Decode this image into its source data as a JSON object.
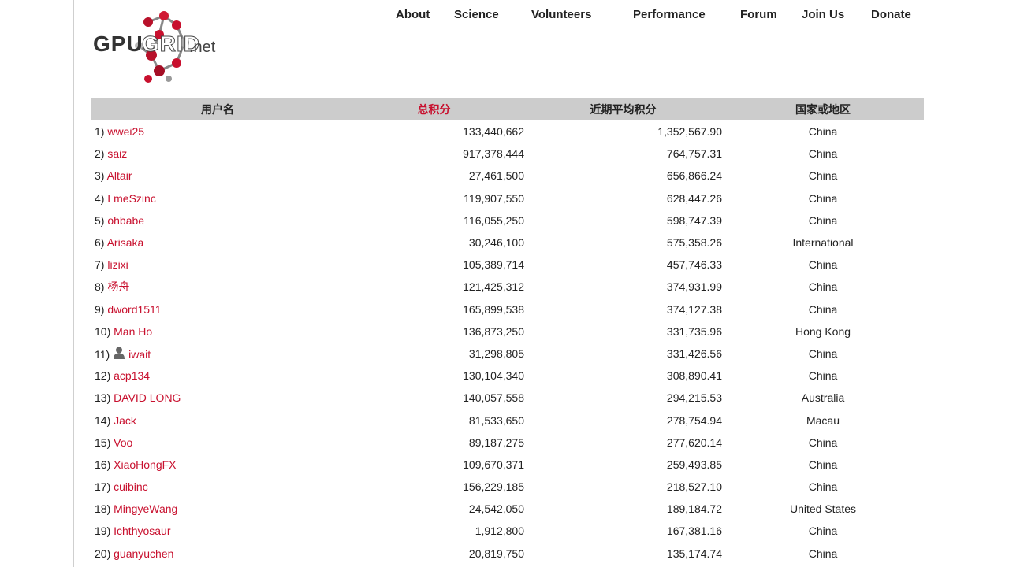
{
  "logo": {
    "gpu": "GPU",
    "grid": "GRID",
    "net": ".net"
  },
  "nav": [
    {
      "label": "About"
    },
    {
      "label": "Science"
    },
    {
      "label": "Volunteers"
    },
    {
      "label": "Performance"
    },
    {
      "label": "Forum"
    },
    {
      "label": "Join Us"
    },
    {
      "label": "Donate"
    }
  ],
  "table": {
    "headers": [
      "用户名",
      "总积分",
      "近期平均积分",
      "国家或地区"
    ],
    "rows": [
      {
        "rank": "1)",
        "name": "wwei25",
        "total": "133,440,662",
        "rac": "1,352,567.90",
        "country": "China"
      },
      {
        "rank": "2)",
        "name": "saiz",
        "total": "917,378,444",
        "rac": "764,757.31",
        "country": "China"
      },
      {
        "rank": "3)",
        "name": "Altair",
        "total": "27,461,500",
        "rac": "656,866.24",
        "country": "China"
      },
      {
        "rank": "4)",
        "name": "LmeSzinc",
        "total": "119,907,550",
        "rac": "628,447.26",
        "country": "China"
      },
      {
        "rank": "5)",
        "name": "ohbabe",
        "total": "116,055,250",
        "rac": "598,747.39",
        "country": "China"
      },
      {
        "rank": "6)",
        "name": "Arisaka",
        "total": "30,246,100",
        "rac": "575,358.26",
        "country": "International"
      },
      {
        "rank": "7)",
        "name": "lizixi",
        "total": "105,389,714",
        "rac": "457,746.33",
        "country": "China"
      },
      {
        "rank": "8)",
        "name": "杨舟",
        "total": "121,425,312",
        "rac": "374,931.99",
        "country": "China"
      },
      {
        "rank": "9)",
        "name": "dword1511",
        "total": "165,899,538",
        "rac": "374,127.38",
        "country": "China"
      },
      {
        "rank": "10)",
        "name": "Man Ho",
        "total": "136,873,250",
        "rac": "331,735.96",
        "country": "Hong Kong"
      },
      {
        "rank": "11)",
        "name": "iwait",
        "total": "31,298,805",
        "rac": "331,426.56",
        "country": "China",
        "has_icon": true
      },
      {
        "rank": "12)",
        "name": "acp134",
        "total": "130,104,340",
        "rac": "308,890.41",
        "country": "China"
      },
      {
        "rank": "13)",
        "name": "DAVID LONG",
        "total": "140,057,558",
        "rac": "294,215.53",
        "country": "Australia"
      },
      {
        "rank": "14)",
        "name": "Jack",
        "total": "81,533,650",
        "rac": "278,754.94",
        "country": "Macau"
      },
      {
        "rank": "15)",
        "name": "Voo",
        "total": "89,187,275",
        "rac": "277,620.14",
        "country": "China"
      },
      {
        "rank": "16)",
        "name": "XiaoHongFX",
        "total": "109,670,371",
        "rac": "259,493.85",
        "country": "China"
      },
      {
        "rank": "17)",
        "name": "cuibinc",
        "total": "156,229,185",
        "rac": "218,527.10",
        "country": "China"
      },
      {
        "rank": "18)",
        "name": "MingyeWang",
        "total": "24,542,050",
        "rac": "189,184.72",
        "country": "United States"
      },
      {
        "rank": "19)",
        "name": "Ichthyosaur",
        "total": "1,912,800",
        "rac": "167,381.16",
        "country": "China"
      },
      {
        "rank": "20)",
        "name": "guanyuchen",
        "total": "20,819,750",
        "rac": "135,174.74",
        "country": "China"
      }
    ]
  },
  "colors": {
    "link": "#c8102e",
    "header_bg": "#cccccc",
    "sorted_header": "#c8102e"
  }
}
